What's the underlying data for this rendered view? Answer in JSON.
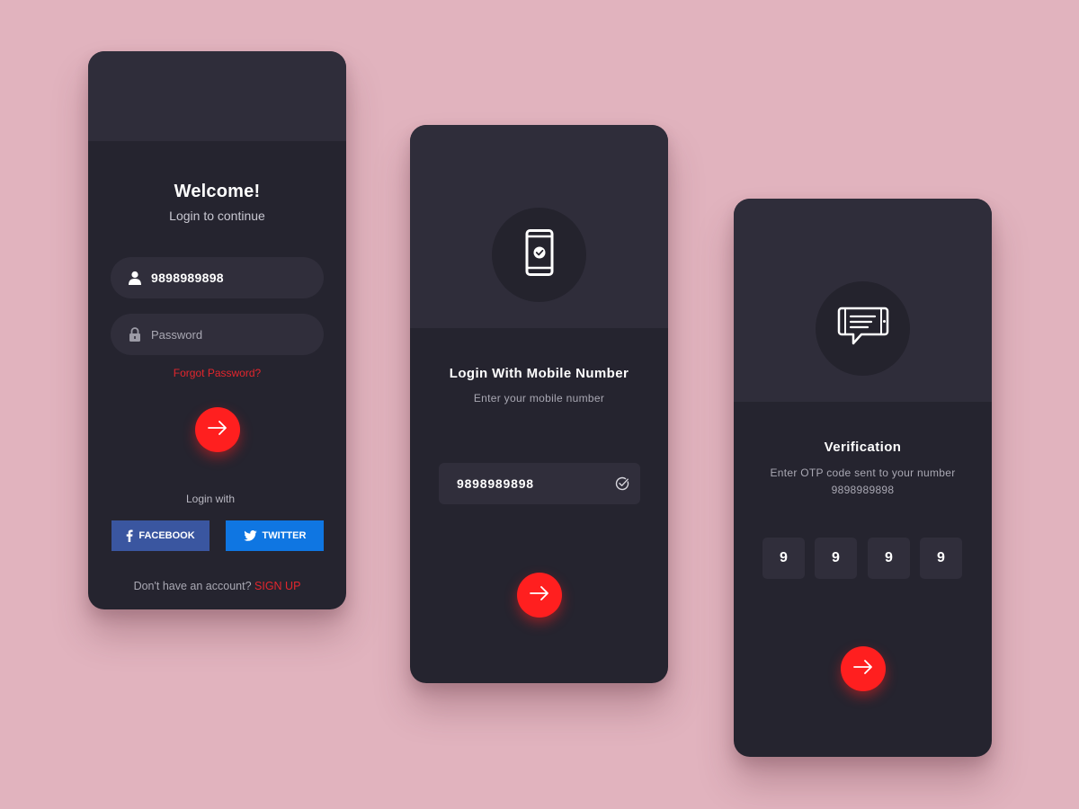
{
  "login_screen": {
    "title": "Welcome!",
    "subtitle": "Login to continue",
    "username_value": "9898989898",
    "password_placeholder": "Password",
    "forgot_password": "Forgot Password?",
    "login_with": "Login with",
    "facebook_label": "FACEBOOK",
    "twitter_label": "TWITTER",
    "no_account_text": "Don't have an account?",
    "signup_label": "SIGN UP"
  },
  "mobile_screen": {
    "title": "Login With Mobile Number",
    "subtitle": "Enter your mobile number",
    "mobile_value": "9898989898"
  },
  "verify_screen": {
    "title": "Verification",
    "subtitle_line1": "Enter OTP code sent to your number",
    "subtitle_line2": "9898989898",
    "otp_digits": [
      "9",
      "9",
      "9",
      "9"
    ]
  },
  "icons": {
    "user": "user-icon",
    "lock": "lock-icon",
    "arrow": "arrow-right-icon",
    "facebook": "facebook-icon",
    "twitter": "twitter-icon",
    "phone": "phone-check-icon",
    "check": "check-circle-icon",
    "message": "message-icon"
  },
  "colors": {
    "background": "#e1b3be",
    "card": "#25242f",
    "card_header": "#2f2d3a",
    "input": "#302e3b",
    "accent_red": "#ff1f1f",
    "facebook_blue": "#3a56a0",
    "twitter_blue": "#0f76e2"
  }
}
